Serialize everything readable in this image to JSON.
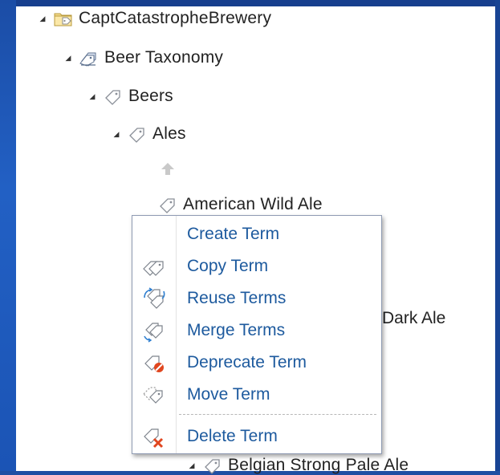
{
  "tree": {
    "root": {
      "label": "CaptCatastropheBrewery",
      "expander": "◢"
    },
    "taxonomy": {
      "label": "Beer Taxonomy",
      "expander": "◢"
    },
    "beers": {
      "label": "Beers",
      "expander": "◢"
    },
    "ales": {
      "label": "Ales",
      "expander": "◢"
    },
    "american_wild_ale": {
      "label": "American Wild Ale"
    },
    "partial_dark_ale": {
      "label": "Dark Ale"
    },
    "cut_off_node": {
      "label": "Belgian Strong Pale Ale",
      "expander": "◢"
    }
  },
  "context_menu": {
    "items": [
      {
        "label": "Create Term",
        "icon": "none"
      },
      {
        "label": "Copy Term",
        "icon": "copy-tags-icon"
      },
      {
        "label": "Reuse Terms",
        "icon": "reuse-tags-icon"
      },
      {
        "label": "Merge Terms",
        "icon": "merge-tags-icon"
      },
      {
        "label": "Deprecate Term",
        "icon": "deprecate-tag-icon"
      },
      {
        "label": "Move Term",
        "icon": "move-tag-icon"
      },
      {
        "label": "Delete Term",
        "icon": "delete-tag-icon"
      }
    ]
  },
  "colors": {
    "background_blue": "#1f4fa3",
    "menu_text": "#1d5a9e",
    "tree_text": "#222222"
  }
}
